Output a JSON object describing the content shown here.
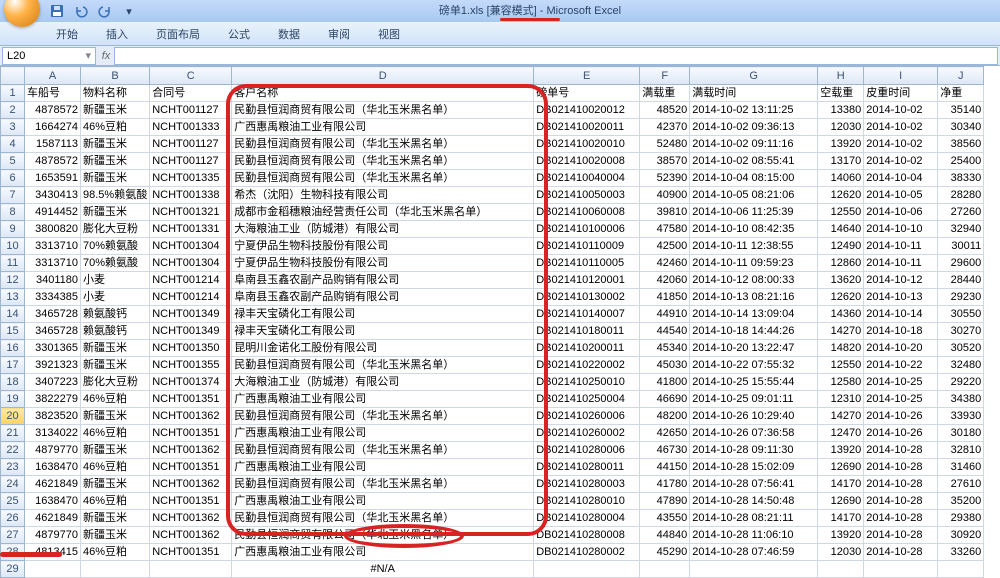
{
  "title": "磅单1.xls [兼容模式] - Microsoft Excel",
  "menus": [
    "开始",
    "插入",
    "页面布局",
    "公式",
    "数据",
    "审阅",
    "视图"
  ],
  "name_box": "L20",
  "fx_label": "fx",
  "col_letters": [
    "A",
    "B",
    "C",
    "D",
    "E",
    "F",
    "G",
    "H",
    "I",
    "J"
  ],
  "headers": [
    "车船号",
    "物料名称",
    "合同号",
    "客户名称",
    "磅单号",
    "满载重",
    "满载时间",
    "空载重",
    "皮重时间",
    "净重"
  ],
  "rows": [
    [
      "4878572",
      "新疆玉米",
      "NCHT001127",
      "民勤县恒润商贸有限公司（华北玉米黑名单）",
      "DB021410020012",
      "48520",
      "2014-10-02 13:11:25",
      "13380",
      "2014-10-02",
      "35140"
    ],
    [
      "1664274",
      "46%豆粕",
      "NCHT001333",
      "广西惠禹粮油工业有限公司",
      "DB021410020011",
      "42370",
      "2014-10-02 09:36:13",
      "12030",
      "2014-10-02",
      "30340"
    ],
    [
      "1587113",
      "新疆玉米",
      "NCHT001127",
      "民勤县恒润商贸有限公司（华北玉米黑名单）",
      "DB021410020010",
      "52480",
      "2014-10-02 09:11:16",
      "13920",
      "2014-10-02",
      "38560"
    ],
    [
      "4878572",
      "新疆玉米",
      "NCHT001127",
      "民勤县恒润商贸有限公司（华北玉米黑名单）",
      "DB021410020008",
      "38570",
      "2014-10-02 08:55:41",
      "13170",
      "2014-10-02",
      "25400"
    ],
    [
      "1653591",
      "新疆玉米",
      "NCHT001335",
      "民勤县恒润商贸有限公司（华北玉米黑名单）",
      "DB021410040004",
      "52390",
      "2014-10-04 08:15:00",
      "14060",
      "2014-10-04",
      "38330"
    ],
    [
      "3430413",
      "98.5%赖氨酸",
      "NCHT001338",
      "希杰（沈阳）生物科技有限公司",
      "DB021410050003",
      "40900",
      "2014-10-05 08:21:06",
      "12620",
      "2014-10-05",
      "28280"
    ],
    [
      "4914452",
      "新疆玉米",
      "NCHT001321",
      "成都市金稻穗粮油经营责任公司（华北玉米黑名单）",
      "DB021410060008",
      "39810",
      "2014-10-06 11:25:39",
      "12550",
      "2014-10-06",
      "27260"
    ],
    [
      "3800820",
      "膨化大豆粉",
      "NCHT001331",
      "大海粮油工业（防城港）有限公司",
      "DB021410100006",
      "47580",
      "2014-10-10 08:42:35",
      "14640",
      "2014-10-10",
      "32940"
    ],
    [
      "3313710",
      "70%赖氨酸",
      "NCHT001304",
      "宁夏伊品生物科技股份有限公司",
      "DB021410110009",
      "42500",
      "2014-10-11 12:38:55",
      "12490",
      "2014-10-11",
      "30011"
    ],
    [
      "3313710",
      "70%赖氨酸",
      "NCHT001304",
      "宁夏伊品生物科技股份有限公司",
      "DB021410110005",
      "42460",
      "2014-10-11 09:59:23",
      "12860",
      "2014-10-11",
      "29600"
    ],
    [
      "3401180",
      "小麦",
      "NCHT001214",
      "阜南县玉鑫农副产品购销有限公司",
      "DB021410120001",
      "42060",
      "2014-10-12 08:00:33",
      "13620",
      "2014-10-12",
      "28440"
    ],
    [
      "3334385",
      "小麦",
      "NCHT001214",
      "阜南县玉鑫农副产品购销有限公司",
      "DB021410130002",
      "41850",
      "2014-10-13 08:21:16",
      "12620",
      "2014-10-13",
      "29230"
    ],
    [
      "3465728",
      "赖氨酸钙",
      "NCHT001349",
      "禄丰天宝磷化工有限公司",
      "DB021410140007",
      "44910",
      "2014-10-14 13:09:04",
      "14360",
      "2014-10-14",
      "30550"
    ],
    [
      "3465728",
      "赖氨酸钙",
      "NCHT001349",
      "禄丰天宝磷化工有限公司",
      "DB021410180011",
      "44540",
      "2014-10-18 14:44:26",
      "14270",
      "2014-10-18",
      "30270"
    ],
    [
      "3301365",
      "新疆玉米",
      "NCHT001350",
      "昆明川金诺化工股份有限公司",
      "DB021410200011",
      "45340",
      "2014-10-20 13:22:47",
      "14820",
      "2014-10-20",
      "30520"
    ],
    [
      "3921323",
      "新疆玉米",
      "NCHT001355",
      "民勤县恒润商贸有限公司（华北玉米黑名单）",
      "DB021410220002",
      "45030",
      "2014-10-22 07:55:32",
      "12550",
      "2014-10-22",
      "32480"
    ],
    [
      "3407223",
      "膨化大豆粉",
      "NCHT001374",
      "大海粮油工业（防城港）有限公司",
      "DB021410250010",
      "41800",
      "2014-10-25 15:55:44",
      "12580",
      "2014-10-25",
      "29220"
    ],
    [
      "3822279",
      "46%豆粕",
      "NCHT001351",
      "广西惠禹粮油工业有限公司",
      "DB021410250004",
      "46690",
      "2014-10-25 09:01:11",
      "12310",
      "2014-10-25",
      "34380"
    ],
    [
      "3823520",
      "新疆玉米",
      "NCHT001362",
      "民勤县恒润商贸有限公司（华北玉米黑名单）",
      "DB021410260006",
      "48200",
      "2014-10-26 10:29:40",
      "14270",
      "2014-10-26",
      "33930"
    ],
    [
      "3134022",
      "46%豆粕",
      "NCHT001351",
      "广西惠禹粮油工业有限公司",
      "DB021410260002",
      "42650",
      "2014-10-26 07:36:58",
      "12470",
      "2014-10-26",
      "30180"
    ],
    [
      "4879770",
      "新疆玉米",
      "NCHT001362",
      "民勤县恒润商贸有限公司（华北玉米黑名单）",
      "DB021410280006",
      "46730",
      "2014-10-28 09:11:30",
      "13920",
      "2014-10-28",
      "32810"
    ],
    [
      "1638470",
      "46%豆粕",
      "NCHT001351",
      "广西惠禹粮油工业有限公司",
      "DB021410280011",
      "44150",
      "2014-10-28 15:02:09",
      "12690",
      "2014-10-28",
      "31460"
    ],
    [
      "4621849",
      "新疆玉米",
      "NCHT001362",
      "民勤县恒润商贸有限公司（华北玉米黑名单）",
      "DB021410280003",
      "41780",
      "2014-10-28 07:56:41",
      "14170",
      "2014-10-28",
      "27610"
    ],
    [
      "1638470",
      "46%豆粕",
      "NCHT001351",
      "广西惠禹粮油工业有限公司",
      "DB021410280010",
      "47890",
      "2014-10-28 14:50:48",
      "12690",
      "2014-10-28",
      "35200"
    ],
    [
      "4621849",
      "新疆玉米",
      "NCHT001362",
      "民勤县恒润商贸有限公司（华北玉米黑名单）",
      "DB021410280004",
      "43550",
      "2014-10-28 08:21:11",
      "14170",
      "2014-10-28",
      "29380"
    ],
    [
      "4879770",
      "新疆玉米",
      "NCHT001362",
      "民勤县恒润商贸有限公司（华北玉米黑名单）",
      "DB021410280008",
      "44840",
      "2014-10-28 11:06:10",
      "13920",
      "2014-10-28",
      "30920"
    ],
    [
      "4813415",
      "46%豆粕",
      "NCHT001351",
      "广西惠禹粮油工业有限公司",
      "DB021410280002",
      "45290",
      "2014-10-28 07:46:59",
      "12030",
      "2014-10-28",
      "33260"
    ]
  ],
  "na": "#N/A",
  "chart_data": {
    "type": "table",
    "note": "spreadsheet grid, no chart present"
  }
}
